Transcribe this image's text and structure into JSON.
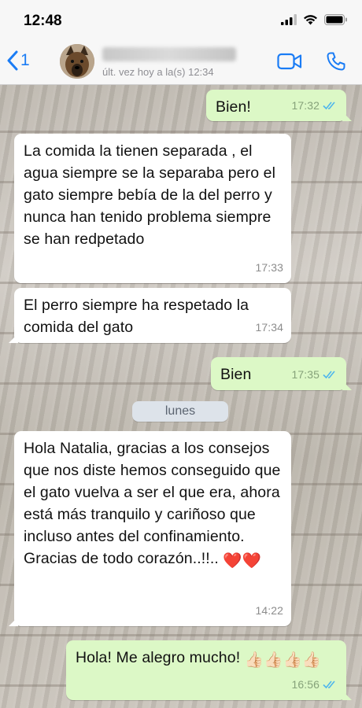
{
  "status_bar": {
    "time": "12:48"
  },
  "header": {
    "back_count": "1",
    "last_seen": "últ. vez hoy a la(s) 12:34"
  },
  "chat": {
    "day_separator": "lunes",
    "messages": [
      {
        "direction": "out",
        "text": "Bien!",
        "time": "17:32",
        "read": true
      },
      {
        "direction": "in",
        "text": "La comida la tienen separada , el agua siempre se la separaba pero el gato siempre bebía de la del perro y nunca han tenido problema siempre se han redpetado",
        "time": "17:33"
      },
      {
        "direction": "in",
        "text": "El perro siempre ha respetado la comida del gato",
        "time": "17:34"
      },
      {
        "direction": "out",
        "text": "Bien",
        "time": "17:35",
        "read": true
      },
      {
        "direction": "in",
        "text": "Hola Natalia, gracias a los consejos que nos diste hemos conseguido que el gato vuelva a ser el que era, ahora está más tranquilo y cariñoso que incluso antes del confinamiento. Gracias de todo corazón..!!..",
        "time": "14:22",
        "emoji": "❤️❤️"
      },
      {
        "direction": "out",
        "text": "Hola! Me alegro mucho!",
        "time": "16:56",
        "read": true,
        "emoji": "👍🏻👍🏻👍🏻👍🏻"
      }
    ]
  },
  "colors": {
    "accent": "#1a7cf5",
    "incoming_bubble": "#ffffff",
    "outgoing_bubble": "#dcf8c6",
    "read_ticks": "#4fb6ec"
  },
  "icons": [
    "back-chevron-icon",
    "signal-icon",
    "wifi-icon",
    "battery-icon",
    "video-call-icon",
    "phone-icon",
    "double-check-icon",
    "heart-icon",
    "thumbs-up-icon"
  ]
}
